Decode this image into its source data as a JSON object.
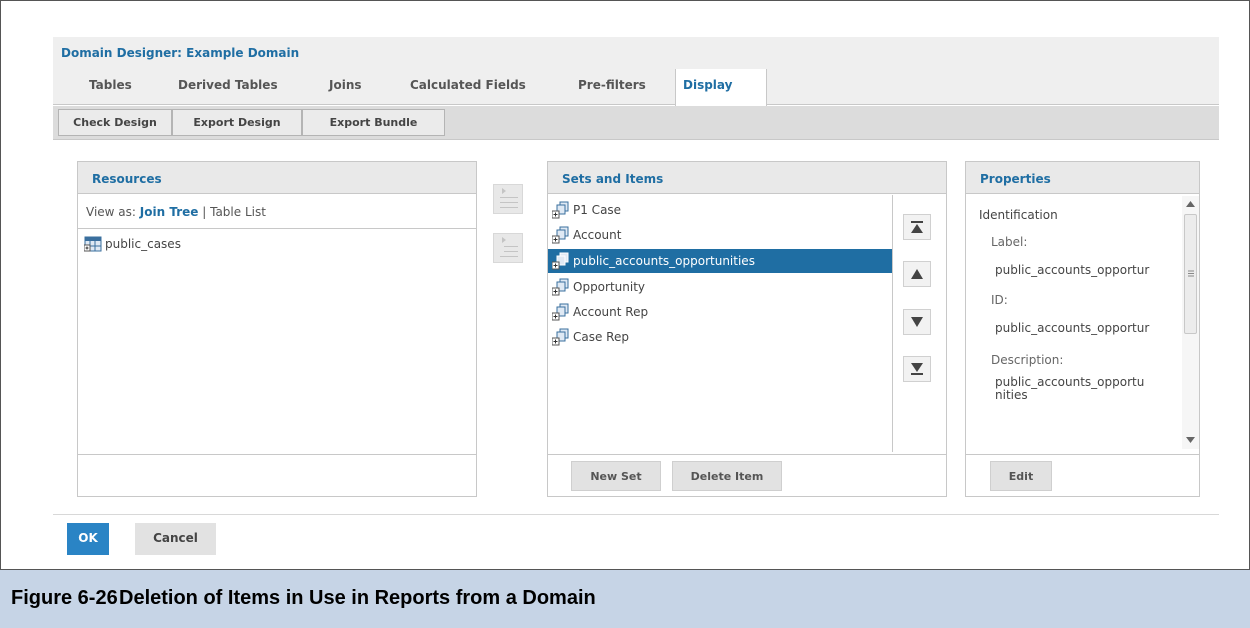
{
  "window": {
    "title": "Domain Designer: Example Domain"
  },
  "tabs": [
    {
      "label": "Tables",
      "active": false
    },
    {
      "label": "Derived Tables",
      "active": false
    },
    {
      "label": "Joins",
      "active": false
    },
    {
      "label": "Calculated Fields",
      "active": false
    },
    {
      "label": "Pre-filters",
      "active": false
    },
    {
      "label": "Display",
      "active": true
    }
  ],
  "toolbar": {
    "check_design": "Check Design",
    "export_design": "Export Design",
    "export_bundle": "Export Bundle"
  },
  "resources": {
    "title": "Resources",
    "view_as_label": "View as:",
    "view_join_tree": "Join Tree",
    "separator": "|",
    "view_table_list": "Table List",
    "items": [
      {
        "label": "public_cases",
        "icon": "table-icon"
      }
    ]
  },
  "sets_and_items": {
    "title": "Sets and Items",
    "items": [
      {
        "label": "P1 Case",
        "icon": "set-icon",
        "selected": false
      },
      {
        "label": "Account",
        "icon": "set-icon",
        "selected": false
      },
      {
        "label": "public_accounts_opportunities",
        "icon": "set-icon",
        "selected": true
      },
      {
        "label": "Opportunity",
        "icon": "set-icon",
        "selected": false
      },
      {
        "label": "Account Rep",
        "icon": "set-icon",
        "selected": false
      },
      {
        "label": "Case Rep",
        "icon": "set-icon",
        "selected": false
      }
    ],
    "new_set": "New Set",
    "delete_item": "Delete Item"
  },
  "properties": {
    "title": "Properties",
    "section": "Identification",
    "label_label": "Label:",
    "label_value": "public_accounts_opportur",
    "id_label": "ID:",
    "id_value": "public_accounts_opportur",
    "description_label": "Description:",
    "description_line1": "public_accounts_opportu",
    "description_line2": "nities",
    "edit": "Edit"
  },
  "footer": {
    "ok": "OK",
    "cancel": "Cancel"
  },
  "caption": {
    "number": "Figure 6-26",
    "text": "Deletion of Items in Use in Reports from a Domain"
  },
  "colors": {
    "accent": "#1f6ea3",
    "ok_button": "#2a84c5",
    "caption_bg": "#c6d4e6"
  }
}
